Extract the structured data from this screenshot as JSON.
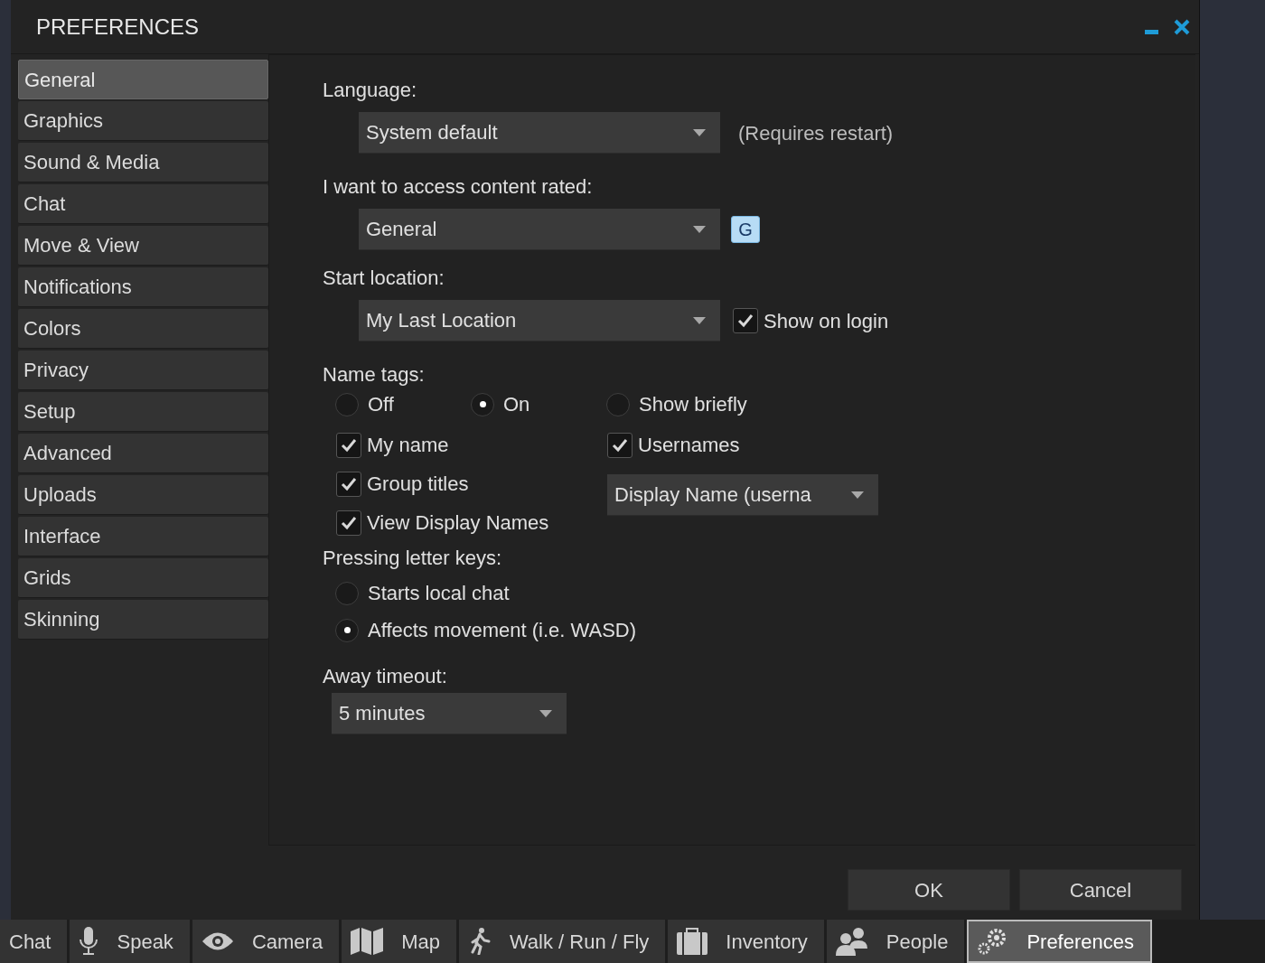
{
  "window": {
    "title": "PREFERENCES"
  },
  "sidebar": {
    "items": [
      {
        "label": "General",
        "selected": true
      },
      {
        "label": "Graphics",
        "selected": false
      },
      {
        "label": "Sound & Media",
        "selected": false
      },
      {
        "label": "Chat",
        "selected": false
      },
      {
        "label": "Move & View",
        "selected": false
      },
      {
        "label": "Notifications",
        "selected": false
      },
      {
        "label": "Colors",
        "selected": false
      },
      {
        "label": "Privacy",
        "selected": false
      },
      {
        "label": "Setup",
        "selected": false
      },
      {
        "label": "Advanced",
        "selected": false
      },
      {
        "label": "Uploads",
        "selected": false
      },
      {
        "label": "Interface",
        "selected": false
      },
      {
        "label": "Grids",
        "selected": false
      },
      {
        "label": "Skinning",
        "selected": false
      }
    ]
  },
  "general": {
    "language": {
      "label": "Language:",
      "value": "System default",
      "note": "(Requires restart)"
    },
    "rating": {
      "label": "I want to access content rated:",
      "value": "General",
      "badge": "G"
    },
    "start_location": {
      "label": "Start location:",
      "value": "My Last Location",
      "show_on_login": {
        "label": "Show on login",
        "checked": true
      }
    },
    "name_tags": {
      "label": "Name tags:",
      "options": [
        {
          "label": "Off",
          "selected": false
        },
        {
          "label": "On",
          "selected": true
        },
        {
          "label": "Show briefly",
          "selected": false
        }
      ],
      "checks": [
        {
          "label": "My name",
          "checked": true
        },
        {
          "label": "Group titles",
          "checked": true
        },
        {
          "label": "View Display Names",
          "checked": true
        }
      ],
      "usernames": {
        "label": "Usernames",
        "checked": true
      },
      "display_format": {
        "value": "Display Name (userna"
      }
    },
    "letter_keys": {
      "label": "Pressing letter keys:",
      "options": [
        {
          "label": "Starts local chat",
          "selected": false
        },
        {
          "label": "Affects movement (i.e. WASD)",
          "selected": true
        }
      ]
    },
    "away_timeout": {
      "label": "Away timeout:",
      "value": "5 minutes"
    }
  },
  "buttons": [
    {
      "label": "OK"
    },
    {
      "label": "Cancel"
    }
  ],
  "toolbar": [
    {
      "label": "Chat",
      "kind": "chat",
      "selected": false
    },
    {
      "label": "Speak",
      "kind": "speak",
      "selected": false
    },
    {
      "label": "Camera",
      "kind": "camera",
      "selected": false
    },
    {
      "label": "Map",
      "kind": "map",
      "selected": false
    },
    {
      "label": "Walk / Run / Fly",
      "kind": "move",
      "selected": false
    },
    {
      "label": "Inventory",
      "kind": "inventory",
      "selected": false
    },
    {
      "label": "People",
      "kind": "people",
      "selected": false
    },
    {
      "label": "Preferences",
      "kind": "preferences",
      "selected": true
    }
  ]
}
